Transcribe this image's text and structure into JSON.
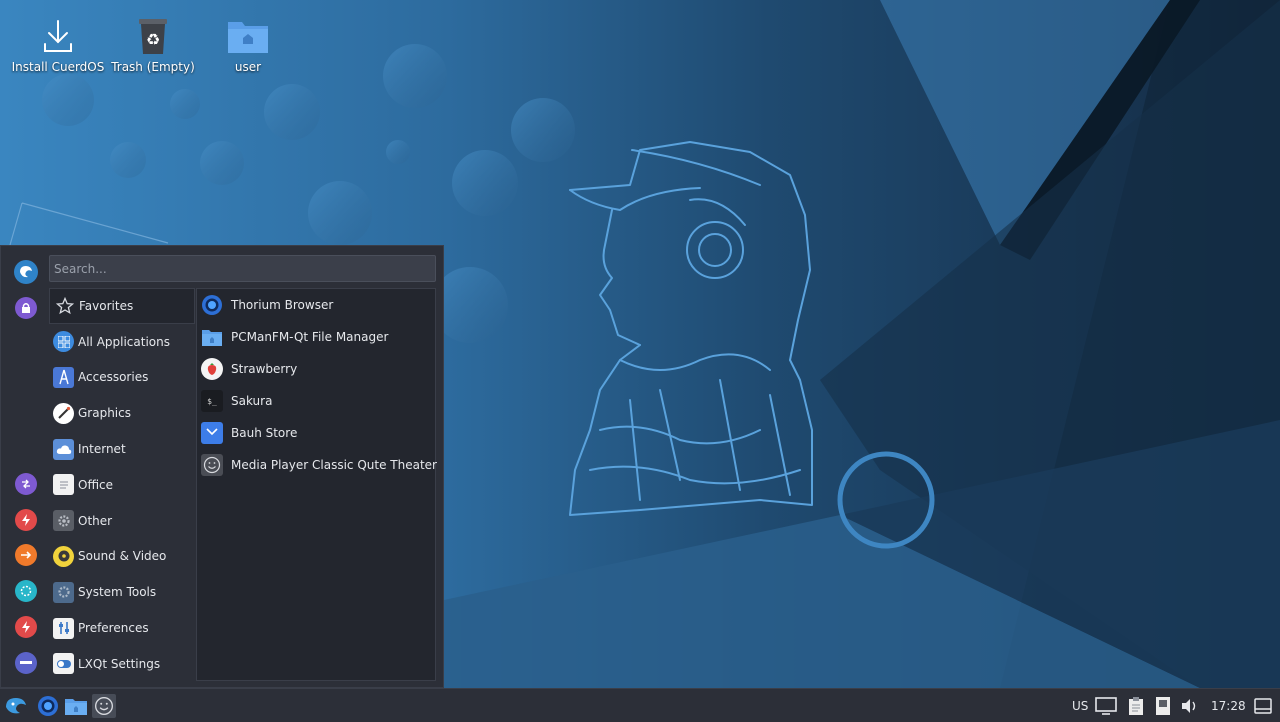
{
  "desktop": {
    "icons": [
      {
        "label": "Install CuerdOS",
        "icon": "download-icon"
      },
      {
        "label": "Trash (Empty)",
        "icon": "trash-icon"
      },
      {
        "label": "user",
        "icon": "home-folder-icon"
      }
    ]
  },
  "menu": {
    "search_placeholder": "Search...",
    "side_buttons": [
      "cuerdos-logo-icon",
      "lock-icon",
      "switch-user-icon",
      "power-icon",
      "logout-icon",
      "settings-gear-icon",
      "reboot-icon",
      "suspend-icon"
    ],
    "categories": [
      {
        "label": "Favorites",
        "icon": "star-icon"
      },
      {
        "label": "All Applications",
        "icon": "all-apps-icon"
      },
      {
        "label": "Accessories",
        "icon": "accessories-icon"
      },
      {
        "label": "Graphics",
        "icon": "graphics-icon"
      },
      {
        "label": "Internet",
        "icon": "cloud-icon"
      },
      {
        "label": "Office",
        "icon": "document-icon"
      },
      {
        "label": "Other",
        "icon": "gear-icon"
      },
      {
        "label": "Sound & Video",
        "icon": "disc-icon"
      },
      {
        "label": "System Tools",
        "icon": "system-tools-icon"
      },
      {
        "label": "Preferences",
        "icon": "sliders-icon"
      },
      {
        "label": "LXQt Settings",
        "icon": "toggle-icon"
      }
    ],
    "apps": [
      {
        "label": "Thorium Browser",
        "icon": "thorium-browser-icon"
      },
      {
        "label": "PCManFM-Qt File Manager",
        "icon": "folder-icon"
      },
      {
        "label": "Strawberry",
        "icon": "strawberry-icon"
      },
      {
        "label": "Sakura",
        "icon": "terminal-icon"
      },
      {
        "label": "Bauh Store",
        "icon": "store-bag-icon"
      },
      {
        "label": "Media Player Classic Qute Theater",
        "icon": "smiley-icon"
      }
    ]
  },
  "taskbar": {
    "launchers": [
      "cuerdos-menu-icon",
      "thorium-browser-icon",
      "file-manager-icon",
      "media-player-icon"
    ],
    "keyboard_layout": "US",
    "clock": "17:28",
    "tray_icons": [
      "display-icon",
      "clipboard-icon",
      "removable-drive-icon",
      "volume-icon",
      "show-desktop-icon"
    ]
  },
  "colors": {
    "panel_bg": "#2c2f38",
    "list_bg": "#23262e",
    "wallpaper_blue": "#2f6ea3",
    "wallpaper_dark": "#14263a"
  }
}
